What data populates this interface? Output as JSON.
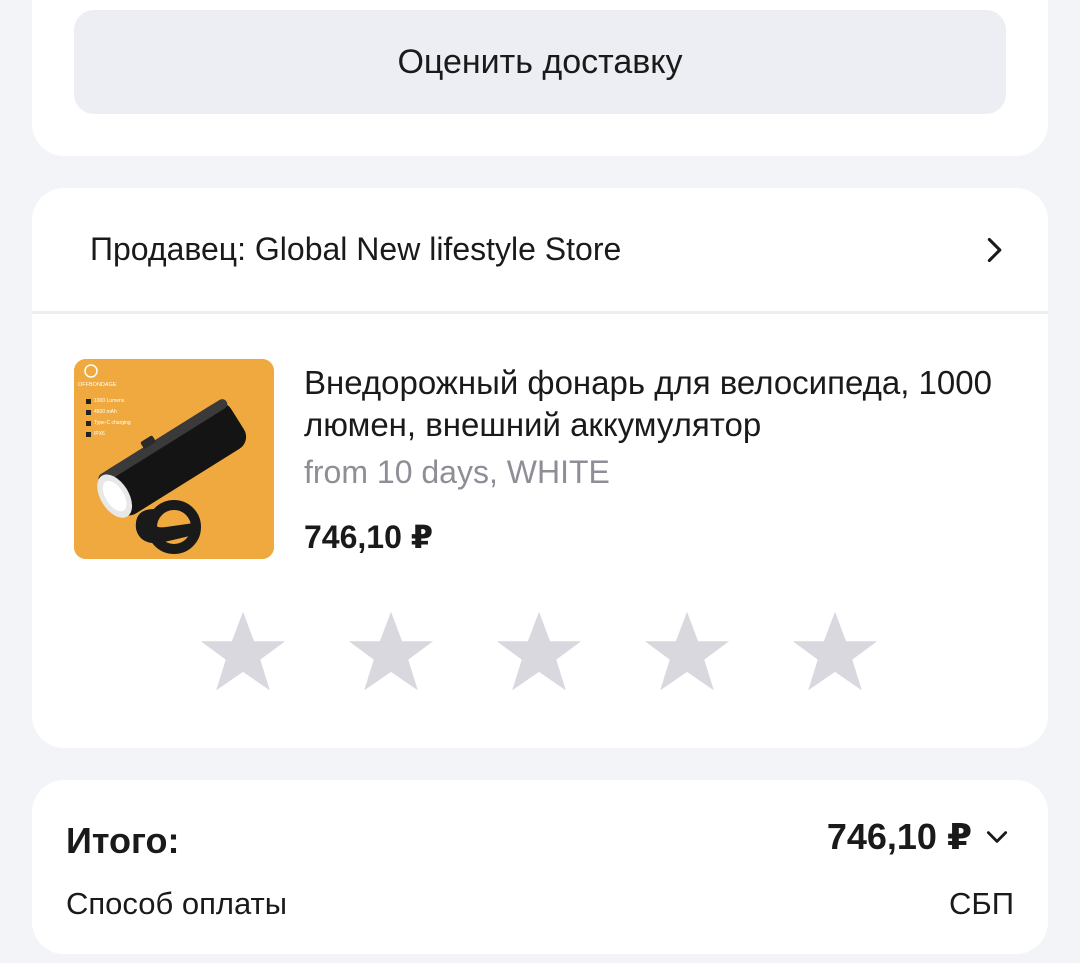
{
  "delivery": {
    "rate_button_label": "Оценить доставку"
  },
  "seller": {
    "label": "Продавец: Global New lifestyle Store",
    "chevron_icon": "chevron-right-icon"
  },
  "product": {
    "title": "Внедорожный фонарь для велосипеда, 1000 люмен, внешний аккумулятор",
    "variant": "from 10 days, WHITE",
    "price": "746,10 ₽",
    "image": {
      "brand": "OFFBONDAGE",
      "features": [
        "1000 Lumens",
        "4500 mAh",
        "Type-C charging",
        "IPX6"
      ],
      "background_color": "#f0a93e"
    },
    "rating": {
      "max_stars": 5,
      "selected": 0,
      "star_color": "#d8d8de"
    }
  },
  "summary": {
    "total_label": "Итого:",
    "total_value": "746,10 ₽",
    "expand_icon": "chevron-down-icon",
    "payment_label": "Способ оплаты",
    "payment_value": "СБП"
  }
}
